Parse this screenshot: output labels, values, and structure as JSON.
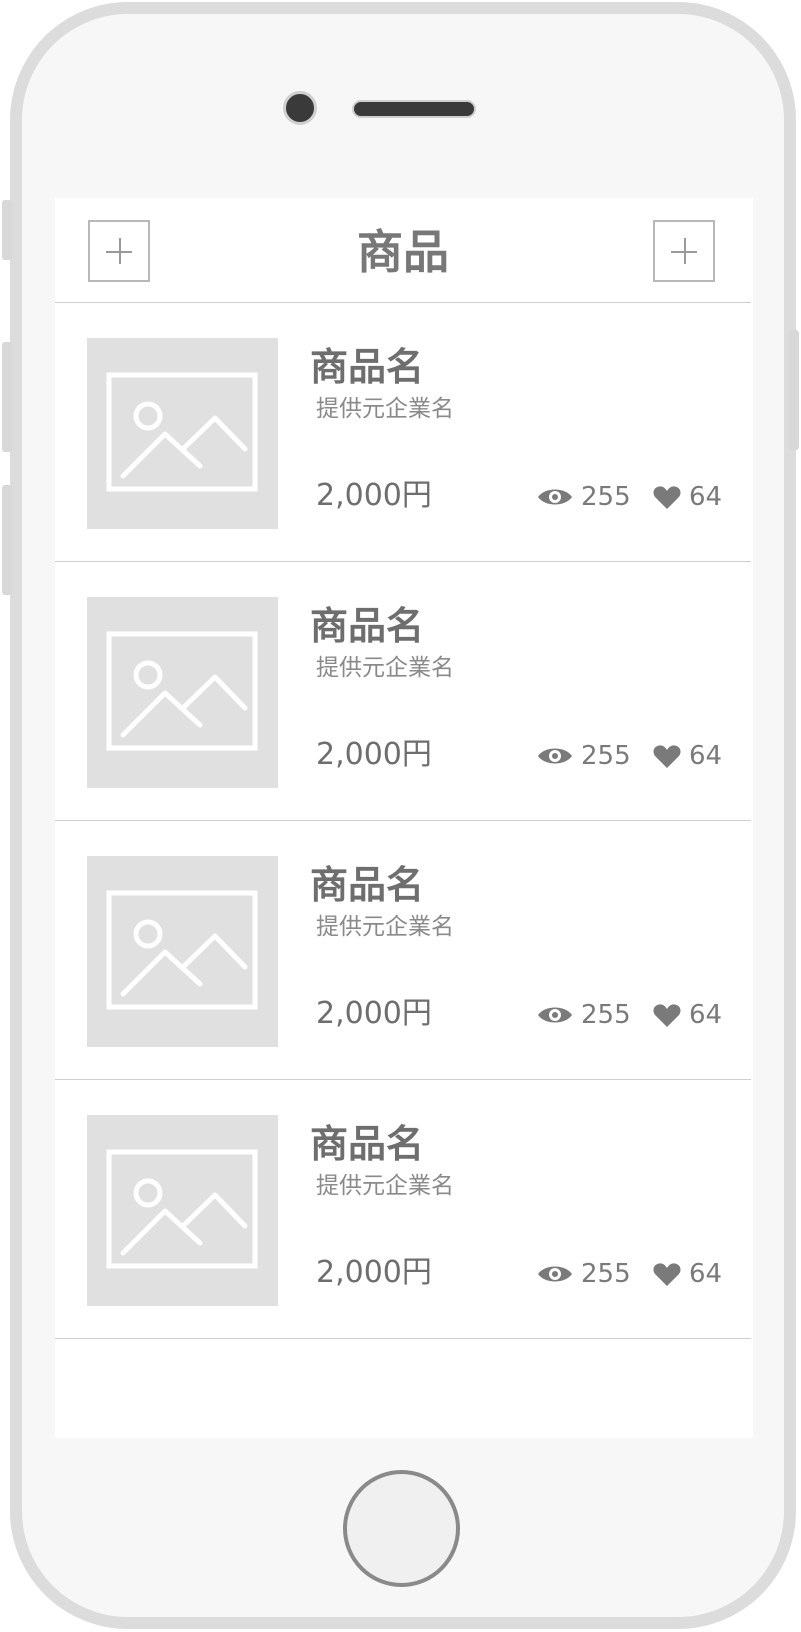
{
  "header": {
    "title": "商品",
    "left_button_icon": "plus-icon",
    "right_button_icon": "plus-icon"
  },
  "products": [
    {
      "name": "商品名",
      "company": "提供元企業名",
      "price": "2,000円",
      "views": "255",
      "likes": "64",
      "image_icon": "image-placeholder-icon"
    },
    {
      "name": "商品名",
      "company": "提供元企業名",
      "price": "2,000円",
      "views": "255",
      "likes": "64",
      "image_icon": "image-placeholder-icon"
    },
    {
      "name": "商品名",
      "company": "提供元企業名",
      "price": "2,000円",
      "views": "255",
      "likes": "64",
      "image_icon": "image-placeholder-icon"
    },
    {
      "name": "商品名",
      "company": "提供元企業名",
      "price": "2,000円",
      "views": "255",
      "likes": "64",
      "image_icon": "image-placeholder-icon"
    }
  ],
  "icons": {
    "views": "eye-icon",
    "likes": "heart-icon"
  },
  "colors": {
    "screen_background": "#ffffff",
    "frame": "#dcdcdc",
    "text_primary": "#6e6e6e",
    "text_secondary": "#8a8a8a",
    "placeholder": "#e0e0e0",
    "divider": "#cfcfcf"
  }
}
